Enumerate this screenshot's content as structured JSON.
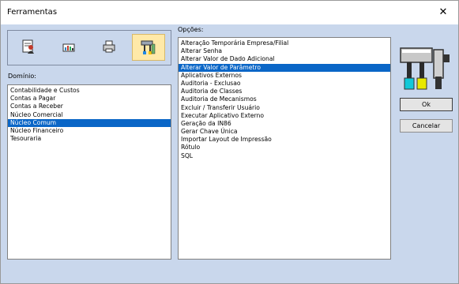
{
  "window": {
    "title": "Ferramentas",
    "close_glyph": "✕"
  },
  "toolbar": {
    "buttons": [
      {
        "name": "user-tool-icon"
      },
      {
        "name": "chart-tool-icon"
      },
      {
        "name": "printer-tool-icon"
      },
      {
        "name": "tools-icon",
        "selected": true
      }
    ]
  },
  "domain": {
    "label": "Domínio:",
    "items": [
      "Contabilidade e Custos",
      "Contas a Pagar",
      "Contas a Receber",
      "Núcleo Comercial",
      "Núcleo Comum",
      "Núcleo Financeiro",
      "Tesouraria"
    ],
    "selected_index": 4
  },
  "options": {
    "label": "Opções:",
    "items": [
      "Alteração Temporária Empresa/Filial",
      "Alterar Senha",
      "Alterar Valor de Dado Adicional",
      "Alterar Valor de Parâmetro",
      "Aplicativos Externos",
      "Auditoria - Exclusao",
      "Auditoria de Classes",
      "Auditoria de Mecanismos",
      "Excluir / Transferir Usuário",
      "Executar Aplicativo Externo",
      "Geração da IN86",
      "Gerar Chave Única",
      "Importar Layout de Impressão",
      "Rótulo",
      "SQL"
    ],
    "selected_index": 3
  },
  "buttons": {
    "ok": "Ok",
    "cancel": "Cancelar"
  },
  "colors": {
    "selection": "#0a66c7",
    "window_bg": "#c9d7ec",
    "toolbar_selected": "#ffe9a8"
  }
}
